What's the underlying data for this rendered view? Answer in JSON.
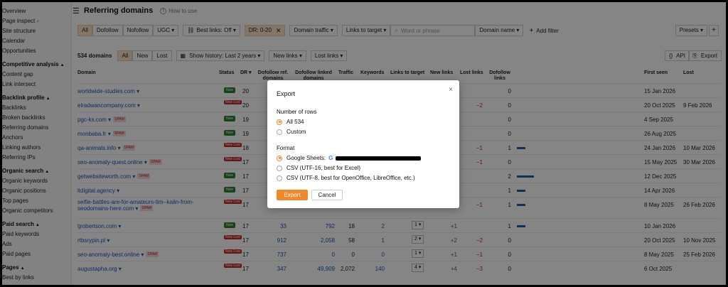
{
  "sidebar": {
    "items": [
      {
        "label": "Overview",
        "type": "item"
      },
      {
        "label": "Page inspect",
        "type": "item",
        "icon": "search-icon"
      },
      {
        "label": "Site structure",
        "type": "item"
      },
      {
        "label": "Calendar",
        "type": "item"
      },
      {
        "label": "Opportunities",
        "type": "item"
      },
      {
        "label": "Competitive analysis",
        "type": "section"
      },
      {
        "label": "Content gap",
        "type": "item"
      },
      {
        "label": "Link intersect",
        "type": "item"
      },
      {
        "label": "Backlink profile",
        "type": "section"
      },
      {
        "label": "Backlinks",
        "type": "item"
      },
      {
        "label": "Broken backlinks",
        "type": "item"
      },
      {
        "label": "Referring domains",
        "type": "item"
      },
      {
        "label": "Anchors",
        "type": "item"
      },
      {
        "label": "Linking authors",
        "type": "item"
      },
      {
        "label": "Referring IPs",
        "type": "item"
      },
      {
        "label": "Organic search",
        "type": "section"
      },
      {
        "label": "Organic keywords",
        "type": "item"
      },
      {
        "label": "Organic positions",
        "type": "item"
      },
      {
        "label": "Top pages",
        "type": "item"
      },
      {
        "label": "Organic competitors",
        "type": "item"
      },
      {
        "label": "Paid search",
        "type": "section"
      },
      {
        "label": "Paid keywords",
        "type": "item"
      },
      {
        "label": "Ads",
        "type": "item"
      },
      {
        "label": "Paid pages",
        "type": "item"
      },
      {
        "label": "Pages",
        "type": "section"
      },
      {
        "label": "Best by links",
        "type": "item"
      }
    ]
  },
  "header": {
    "title": "Referring domains",
    "howto": "How to use"
  },
  "filters": {
    "all": "All",
    "dofollow": "Dofollow",
    "nofollow": "Nofollow",
    "ugc": "UGC ▾",
    "best_links": "Best links: Off ▾",
    "dr": "DR: 0-20",
    "domain_traffic": "Domain traffic ▾",
    "links_to_target": "Links to target ▾",
    "search_placeholder": "Word or phrase",
    "domain_name": "Domain name ▾",
    "add_filter": "Add filter",
    "presets": "Presets ▾",
    "plus": "+"
  },
  "toolbar": {
    "count": "534 domains",
    "all": "All",
    "new": "New",
    "lost": "Lost",
    "history": "Show history: Last 2 years ▾",
    "new_links": "New links ▾",
    "lost_links": "Lost links ▾",
    "api": "API",
    "export": "Export"
  },
  "table": {
    "headers": {
      "domain": "Domain",
      "status": "Status",
      "dr": "DR ▾",
      "dofollow_ref": "Dofollow ref. domains",
      "dofollow_linked": "Dofollow linked domains",
      "traffic": "Traffic",
      "keywords": "Keywords",
      "links_to_target": "Links to target",
      "new_links": "New links",
      "lost_links": "Lost links",
      "dofollow_links": "Dofollow links",
      "first_seen": "First seen",
      "lost": "Lost"
    },
    "rows": [
      {
        "domain": "worldwide-studies.com ▾",
        "spam": "",
        "status": "Now",
        "dr": "20",
        "ref": "",
        "linked": "",
        "traffic": "",
        "kw": "",
        "ltt": "",
        "new": "",
        "lost": "",
        "dof": "0",
        "bar": 0,
        "first": "15 Jan 2026",
        "lostdate": ""
      },
      {
        "domain": "elradwancompany.com ▾",
        "spam": "",
        "status": "New Lost",
        "dr": "20",
        "ref": "",
        "linked": "",
        "traffic": "",
        "kw": "",
        "ltt": "",
        "new": "",
        "lost": "−2",
        "dof": "0",
        "bar": 0,
        "first": "20 Oct 2025",
        "lostdate": "9 Feb 2026"
      },
      {
        "domain": "pgc-ks.com ▾",
        "spam": "SPAM",
        "status": "Now",
        "dr": "19",
        "ref": "",
        "linked": "",
        "traffic": "",
        "kw": "",
        "ltt": "",
        "new": "",
        "lost": "",
        "dof": "0",
        "bar": 0,
        "first": "4 Sep 2025",
        "lostdate": ""
      },
      {
        "domain": "monbaba.fr ▾",
        "spam": "SPAM",
        "status": "Now",
        "dr": "19",
        "ref": "",
        "linked": "",
        "traffic": "",
        "kw": "",
        "ltt": "",
        "new": "",
        "lost": "",
        "dof": "0",
        "bar": 0,
        "first": "26 Aug 2025",
        "lostdate": ""
      },
      {
        "domain": "qa-animals.info ▾",
        "spam": "SPAM",
        "status": "New Lost",
        "dr": "18",
        "ref": "",
        "linked": "",
        "traffic": "",
        "kw": "",
        "ltt": "",
        "new": "",
        "lost": "−1",
        "dof": "1",
        "bar": 1,
        "first": "24 Jan 2026",
        "lostdate": "10 Mar 2026"
      },
      {
        "domain": "seo-anomaly-quest.online ▾",
        "spam": "SPAM",
        "status": "New Lost",
        "dr": "17",
        "ref": "",
        "linked": "",
        "traffic": "",
        "kw": "",
        "ltt": "",
        "new": "",
        "lost": "−1",
        "dof": "0",
        "bar": 0,
        "first": "15 May 2025",
        "lostdate": "30 Mar 2026"
      },
      {
        "domain": "getwebsiteworth.com ▾",
        "spam": "SPAM",
        "status": "Now",
        "dr": "17",
        "ref": "",
        "linked": "",
        "traffic": "",
        "kw": "",
        "ltt": "",
        "new": "",
        "lost": "",
        "dof": "2",
        "bar": 2,
        "first": "12 Dec 2025",
        "lostdate": ""
      },
      {
        "domain": "ltdigital.agency ▾",
        "spam": "",
        "status": "Now",
        "dr": "17",
        "ref": "",
        "linked": "",
        "traffic": "",
        "kw": "",
        "ltt": "",
        "new": "",
        "lost": "",
        "dof": "1",
        "bar": 1,
        "first": "14 Apr 2026",
        "lostdate": ""
      },
      {
        "domain": "selfie-battles-are-for-amateurs-tim--kalin-from-seodomains-here.com ▾",
        "spam": "SPAM",
        "status": "New Lost",
        "dr": "17",
        "ref": "672",
        "linked": "0",
        "traffic": "0",
        "kw": "0",
        "ltt": "1 ▾",
        "new": "+1",
        "lost": "−1",
        "dof": "1",
        "bar": 1,
        "first": "8 May 2025",
        "lostdate": "26 Feb 2026"
      },
      {
        "domain": "tjrobertson.com ▾",
        "spam": "",
        "status": "Now",
        "dr": "17",
        "ref": "33",
        "linked": "792",
        "traffic": "18",
        "kw": "2",
        "ltt": "1 ▾",
        "new": "+1",
        "lost": "",
        "dof": "1",
        "bar": 1,
        "first": "10 Jan 2026",
        "lostdate": ""
      },
      {
        "domain": "rtbsrypin.pl ▾",
        "spam": "",
        "status": "New Lost",
        "dr": "17",
        "ref": "912",
        "linked": "2,058",
        "traffic": "58",
        "kw": "1",
        "ltt": "2 ▾",
        "new": "+2",
        "lost": "−2",
        "dof": "0",
        "bar": 0,
        "first": "20 Oct 2025",
        "lostdate": "10 Nov 2025"
      },
      {
        "domain": "seo-anomaly-best.online ▾",
        "spam": "SPAM",
        "status": "New Lost",
        "dr": "17",
        "ref": "737",
        "linked": "0",
        "traffic": "0",
        "kw": "0",
        "ltt": "1 ▾",
        "new": "+1",
        "lost": "−1",
        "dof": "0",
        "bar": 0,
        "first": "8 May 2025",
        "lostdate": "25 Feb 2026"
      },
      {
        "domain": "augustapha.org ▾",
        "spam": "",
        "status": "New Lost",
        "dr": "17",
        "ref": "347",
        "linked": "49,909",
        "traffic": "2,072",
        "kw": "140",
        "ltt": "4 ▾",
        "new": "+4",
        "lost": "−3",
        "dof": "0",
        "bar": 0,
        "first": "6 Oct 2025",
        "lostdate": ""
      }
    ]
  },
  "modal": {
    "title": "Export",
    "rows_label": "Number of rows",
    "opt_all": "All 534",
    "opt_custom": "Custom",
    "format_label": "Format",
    "opt_sheets": "Google Sheets:",
    "opt_csv16": "CSV (UTF-16, best for Excel)",
    "opt_csv8": "CSV (UTF-8, best for OpenOffice, LibreOffice, etc.)",
    "export_btn": "Export",
    "cancel_btn": "Cancel",
    "close": "×"
  },
  "colors": {
    "accent": "#f0892c",
    "link": "#1a56b8",
    "now": "#2e7d32",
    "lost": "#c62828"
  }
}
